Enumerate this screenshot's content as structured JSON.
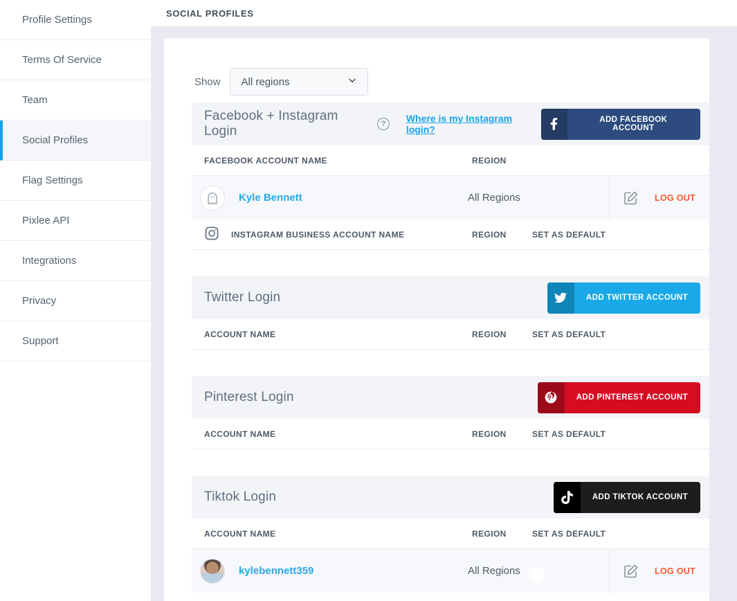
{
  "topbar": {
    "title": "SOCIAL PROFILES"
  },
  "sidebar": {
    "items": [
      {
        "label": "Profile Settings",
        "active": false
      },
      {
        "label": "Terms Of Service",
        "active": false
      },
      {
        "label": "Team",
        "active": false
      },
      {
        "label": "Social Profiles",
        "active": true
      },
      {
        "label": "Flag Settings",
        "active": false
      },
      {
        "label": "Pixlee API",
        "active": false
      },
      {
        "label": "Integrations",
        "active": false
      },
      {
        "label": "Privacy",
        "active": false
      },
      {
        "label": "Support",
        "active": false
      }
    ]
  },
  "filter": {
    "label": "Show",
    "value": "All regions",
    "chevron_icon": "chevron-down"
  },
  "colors": {
    "accent_blue": "#18a0e8",
    "link_blue": "#29a8e8",
    "logout_orange": "#fc5632",
    "toggle_green": "#1f9e55",
    "content_bg": "#e9eaf1",
    "section_header_bg": "#f2f4f8",
    "row_bg": "#f7f8fb"
  },
  "actions": {
    "logout": "LOG OUT",
    "edit_icon": "edit-pencil"
  },
  "sections": [
    {
      "title": "Facebook + Instagram Login",
      "help_icon": "question-circle",
      "help_link": "Where is my Instagram login?",
      "button": {
        "label": "ADD FACEBOOK ACCOUNT",
        "icon": "facebook-f",
        "bg": "#2d4b7e",
        "icon_bg": "#243b63"
      },
      "columns": {
        "name": "FACEBOOK ACCOUNT NAME",
        "region": "REGION",
        "default": ""
      },
      "row": {
        "name": "Kyle Bennett",
        "region": "All Regions",
        "avatar_icon": "ghost"
      },
      "subcolumns": {
        "icon": "instagram",
        "name": "INSTAGRAM BUSINESS ACCOUNT NAME",
        "region": "REGION",
        "default": "SET AS DEFAULT"
      }
    },
    {
      "title": "Twitter Login",
      "button": {
        "label": "ADD TWITTER ACCOUNT",
        "icon": "twitter-bird",
        "bg": "#1aa9e8",
        "icon_bg": "#1085b8"
      },
      "columns": {
        "name": "ACCOUNT NAME",
        "region": "REGION",
        "default": "SET AS DEFAULT"
      }
    },
    {
      "title": "Pinterest Login",
      "button": {
        "label": "ADD PINTEREST ACCOUNT",
        "icon": "pinterest-p",
        "bg": "#d50c22",
        "icon_bg": "#9c0a1a"
      },
      "columns": {
        "name": "ACCOUNT NAME",
        "region": "REGION",
        "default": "SET AS DEFAULT"
      }
    },
    {
      "title": "Tiktok Login",
      "button": {
        "label": "ADD TIKTOK ACCOUNT",
        "icon": "tiktok-note",
        "bg": "#1d1d1d",
        "icon_bg": "#000000"
      },
      "columns": {
        "name": "ACCOUNT NAME",
        "region": "REGION",
        "default": "SET AS DEFAULT"
      },
      "row": {
        "name": "kylebennett359",
        "region": "All Regions",
        "default_on": true,
        "avatar": "profile-photo"
      }
    }
  ]
}
